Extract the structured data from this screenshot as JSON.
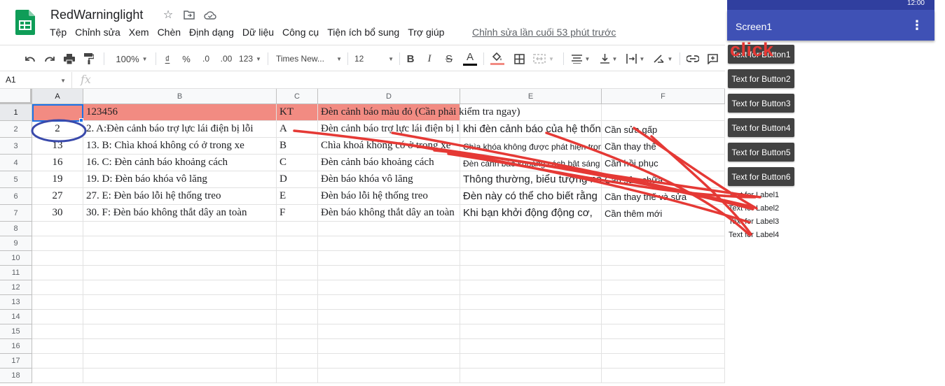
{
  "sheets": {
    "doc_title": "RedWarninglight",
    "menu": [
      "Tệp",
      "Chỉnh sửa",
      "Xem",
      "Chèn",
      "Định dạng",
      "Dữ liệu",
      "Công cụ",
      "Tiện ích bổ sung",
      "Trợ giúp"
    ],
    "last_edit": "Chỉnh sửa lần cuối 53 phút trước",
    "toolbar": {
      "zoom": "100%",
      "currency": "₫",
      "percent": "%",
      "decrease_decimal": ".0",
      "increase_decimal": ".00",
      "number_format": "123",
      "font": "Times New...",
      "font_size": "12",
      "bold": "B",
      "italic": "I",
      "strike": "S",
      "text_color_glyph": "A"
    },
    "name_box": "A1",
    "fx": "fx",
    "columns": [
      "A",
      "B",
      "C",
      "D",
      "E",
      "F"
    ],
    "row_numbers": [
      "1",
      "2",
      "3",
      "4",
      "5",
      "6",
      "7",
      "8",
      "9",
      "10",
      "11",
      "12",
      "13",
      "14",
      "15",
      "16",
      "17",
      "18"
    ],
    "rows": [
      [
        "",
        "123456",
        "KT",
        "Đèn cảnh báo màu đỏ (Cần phải kiểm tra ngay)",
        "",
        ""
      ],
      [
        "2",
        "2. A:Đèn cảnh báo trợ lực lái điện bị lỗi",
        "A",
        "Đèn cảnh báo trợ lực lái điện bị lỗi",
        "khi đèn cảnh báo của hệ thống",
        "Cần sửa gấp"
      ],
      [
        "13",
        "13. B: Chìa khoá không có ở trong xe",
        "B",
        "Chìa khoá không có ở trong xe",
        "Chìa khóa không được phát hiện trong xe",
        "Cần thay thế"
      ],
      [
        "16",
        "16. C: Đèn cảnh báo khoảng cách",
        "C",
        "Đèn cảnh báo khoảng cách",
        "Đèn cảnh báo khoảng cách bật sáng",
        "Cần hồi phục"
      ],
      [
        "19",
        "19. D: Đèn báo khóa vô lăng",
        "D",
        "Đèn báo khóa vô lăng",
        "Thông thường, biểu tượng này",
        "Cần sửa chữa"
      ],
      [
        "27",
        "27. E: Đèn báo lỗi hệ thống treo",
        "E",
        "Đèn báo lỗi hệ thống treo",
        "Đèn này có thể cho biết rằng",
        "Cần thay thế và sửa"
      ],
      [
        "30",
        "30. F: Đèn báo không thắt dây an toàn",
        "F",
        "Đèn báo không thắt dây an toàn",
        "Khi bạn khởi động động cơ,",
        "Cần thêm mới"
      ]
    ],
    "colors": {
      "red_fill": "#f28b82",
      "selection": "#1a73e8",
      "logo_green": "#0f9d58"
    }
  },
  "app": {
    "status_time": "12:00",
    "screen_title": "Screen1",
    "overflow_icon": "⋮",
    "buttons": [
      "Text for Button1",
      "Text for Button2",
      "Text for Button3",
      "Text for Button4",
      "Text for Button5",
      "Text for Button6"
    ],
    "labels": [
      "Text for Label1",
      "Text for Label2",
      "Text for Label3",
      "Text for Label4"
    ],
    "colors": {
      "appbar": "#3f51b5",
      "status_bar": "#303f9f",
      "button_bg": "#424242"
    }
  },
  "annotation": {
    "click_text": "click",
    "color": "#e53935",
    "circle_color": "#3949ab"
  }
}
